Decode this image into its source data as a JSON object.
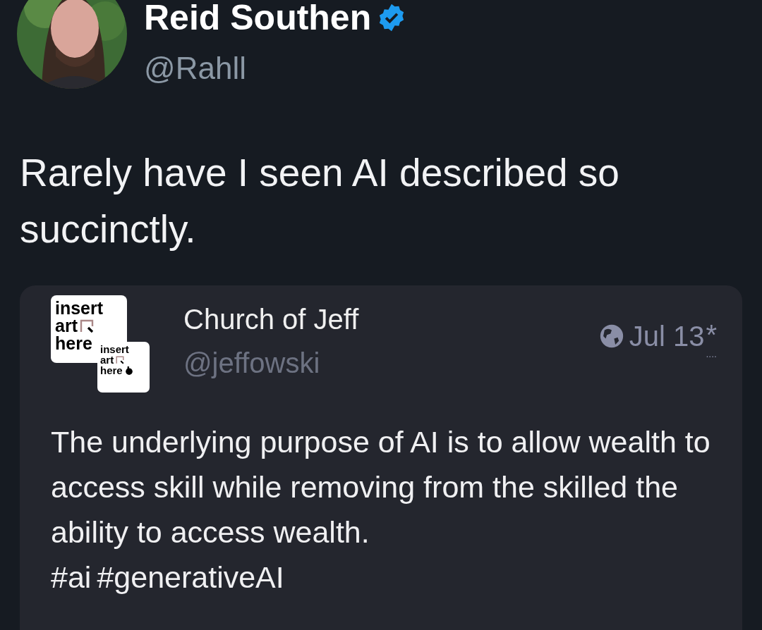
{
  "post": {
    "author": {
      "name": "Reid Southen",
      "verified": true,
      "handle": "@Rahll"
    },
    "text": "Rarely have I seen AI described so succinctly.",
    "quote": {
      "logo": {
        "large": [
          "insert",
          "art",
          "here"
        ],
        "small": [
          "insert",
          "art",
          "here"
        ]
      },
      "author": {
        "name": "Church of Jeff",
        "handle": "@jeffowski"
      },
      "date": "Jul 13",
      "marker": "*",
      "marker_dots": "....",
      "text": "The underlying purpose of AI is to allow wealth to access skill while removing from the skilled the ability to access wealth.",
      "hashtags": [
        "#ai",
        "#generativeAI"
      ]
    }
  }
}
